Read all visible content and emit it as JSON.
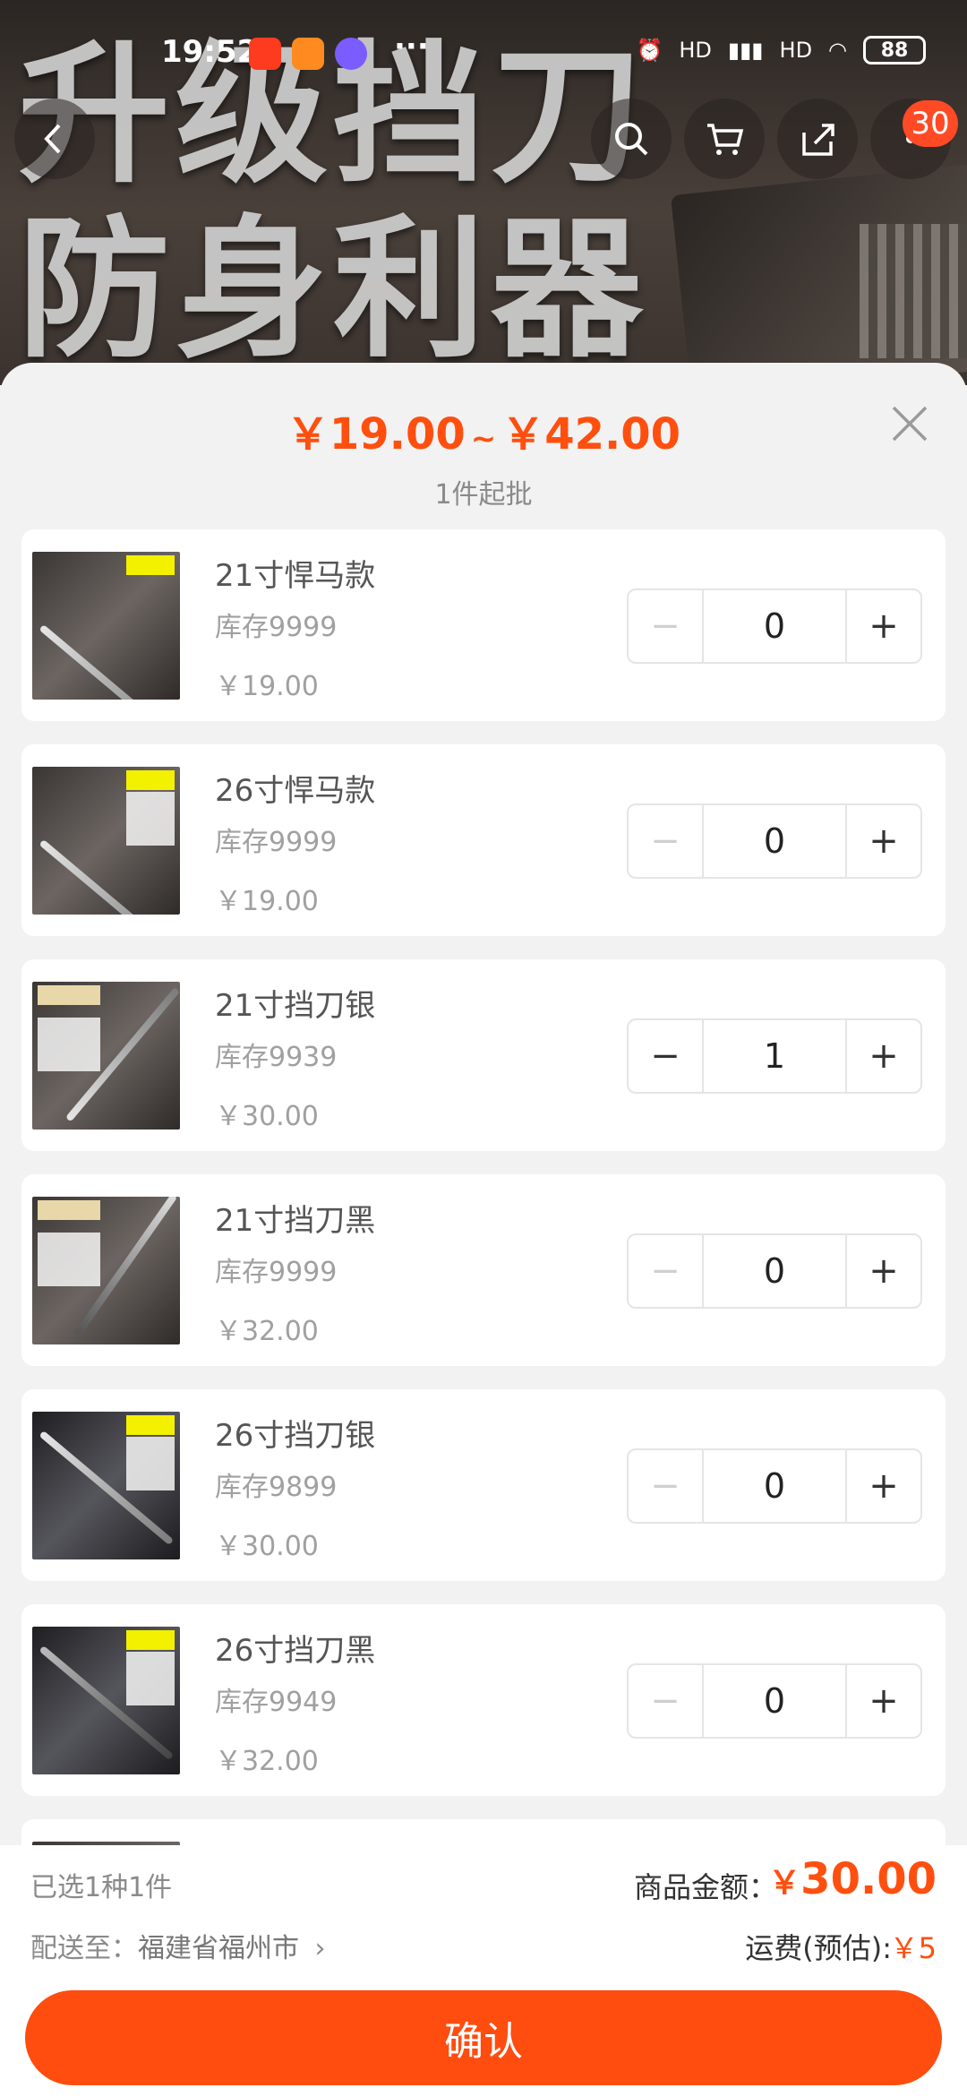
{
  "status_bar": {
    "time": "19:52",
    "signal": "HD",
    "battery": "88"
  },
  "hero": {
    "line1": "升级挡刀",
    "line2": "防身利器"
  },
  "nav": {
    "cart_badge": "30"
  },
  "sheet": {
    "price_min": "￥19.00",
    "price_sep": "~",
    "price_max": "￥42.00",
    "moq": "1件起批"
  },
  "items": [
    {
      "title": "21寸悍马款",
      "stock": "库存9999",
      "price": "￥19.00",
      "qty": "0",
      "minus": "−",
      "plus": "+"
    },
    {
      "title": "26寸悍马款",
      "stock": "库存9999",
      "price": "￥19.00",
      "qty": "0",
      "minus": "−",
      "plus": "+"
    },
    {
      "title": "21寸挡刀银",
      "stock": "库存9939",
      "price": "￥30.00",
      "qty": "1",
      "minus": "−",
      "plus": "+"
    },
    {
      "title": "21寸挡刀黑",
      "stock": "库存9999",
      "price": "￥32.00",
      "qty": "0",
      "minus": "−",
      "plus": "+"
    },
    {
      "title": "26寸挡刀银",
      "stock": "库存9899",
      "price": "￥30.00",
      "qty": "0",
      "minus": "−",
      "plus": "+"
    },
    {
      "title": "26寸挡刀黑",
      "stock": "库存9949",
      "price": "￥32.00",
      "qty": "0",
      "minus": "−",
      "plus": "+"
    }
  ],
  "footer": {
    "selected": "已选1种1件",
    "amount_label": "商品金额：",
    "amount_currency": "￥",
    "amount": "30.00",
    "ship_to_label": "配送至：",
    "ship_to_city": "福建省福州市",
    "fee_label": "运费(预估):",
    "fee": "￥5",
    "confirm": "确认"
  },
  "colors": {
    "accent": "#ff4f0f"
  }
}
